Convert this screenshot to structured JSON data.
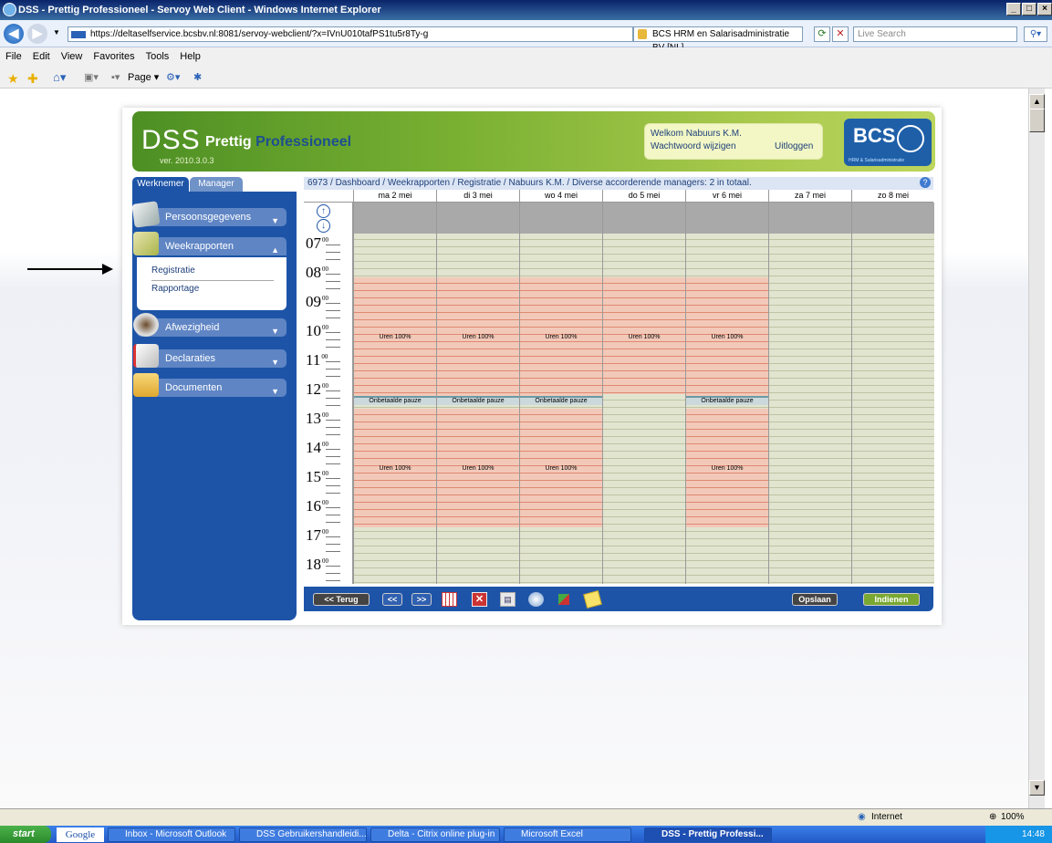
{
  "window": {
    "title": "DSS - Prettig Professioneel - Servoy Web Client - Windows Internet Explorer"
  },
  "address": {
    "url": "https://deltaselfservice.bcsbv.nl:8081/servoy-webclient/?x=IVnU010tafPS1tu5r8Ty-g",
    "cert": "BCS HRM en Salarisadministratie BV [NL]",
    "search_placeholder": "Live Search"
  },
  "menu": [
    "File",
    "Edit",
    "View",
    "Favorites",
    "Tools",
    "Help"
  ],
  "toolbar": {
    "page_label": "Page"
  },
  "app": {
    "logo_main": "DSS",
    "logo_pre": "Prettig",
    "logo_post": "Professioneel",
    "version": "ver. 2010.3.0.3",
    "welcome": "Welkom Nabuurs K.M.",
    "change_password": "Wachtwoord wijzigen",
    "logout": "Uitloggen",
    "brand": "BCS",
    "brand_sub": "HRM & Salarisadministratie"
  },
  "tabs": {
    "employee": "Werknemer",
    "manager": "Manager"
  },
  "sidebar": {
    "items": [
      {
        "label": "Persoonsgegevens"
      },
      {
        "label": "Weekrapporten"
      },
      {
        "label": "Afwezigheid"
      },
      {
        "label": "Declaraties"
      },
      {
        "label": "Documenten"
      }
    ],
    "sub_items": [
      "Registratie",
      "Rapportage"
    ]
  },
  "breadcrumb": "6973 / Dashboard / Weekrapporten / Registratie / Nabuurs K.M. / Diverse accorderende managers: 2 in totaal.",
  "calendar": {
    "days": [
      "ma 2 mei",
      "di 3 mei",
      "wo 4 mei",
      "do 5 mei",
      "vr 6 mei",
      "za 7 mei",
      "zo 8 mei"
    ],
    "hours": [
      "07",
      "08",
      "09",
      "10",
      "11",
      "12",
      "13",
      "14",
      "15",
      "16",
      "17",
      "18"
    ],
    "minutes_label": "00",
    "work_label": "Uren 100%",
    "pause_label": "Onbetaalde pauze"
  },
  "buttons": {
    "back": "<< Terug",
    "prev": "<<",
    "next": ">>",
    "save": "Opslaan",
    "submit": "Indienen"
  },
  "statusbar": {
    "zone": "Internet",
    "zoom": "100%"
  },
  "taskbar": {
    "start": "start",
    "google": "Google",
    "tasks": [
      "Inbox - Microsoft Outlook",
      "DSS Gebruikershandleidi...",
      "Delta - Citrix online plug-in",
      "Microsoft Excel",
      "DSS - Prettig Professi..."
    ],
    "clock": "14:48"
  }
}
